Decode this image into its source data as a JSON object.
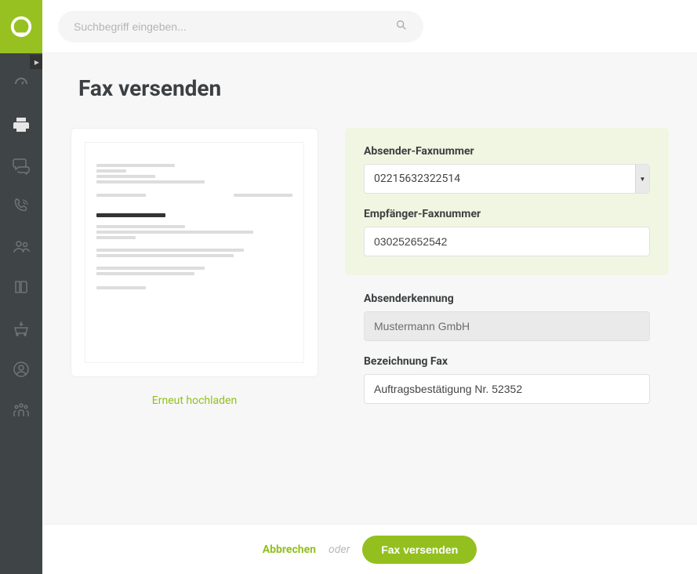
{
  "search": {
    "placeholder": "Suchbegriff eingeben..."
  },
  "page": {
    "title": "Fax versenden"
  },
  "preview": {
    "reupload": "Erneut hochladen"
  },
  "form": {
    "sender_fax_label": "Absender-Faxnummer",
    "sender_fax_value": "02215632322514",
    "recipient_fax_label": "Empfänger-Faxnummer",
    "recipient_fax_value": "030252652542",
    "sender_id_label": "Absenderkennung",
    "sender_id_value": "Mustermann GmbH",
    "fax_name_label": "Bezeichnung Fax",
    "fax_name_value": "Auftragsbestätigung Nr. 52352"
  },
  "footer": {
    "cancel": "Abbrechen",
    "or": "oder",
    "submit": "Fax versenden"
  }
}
